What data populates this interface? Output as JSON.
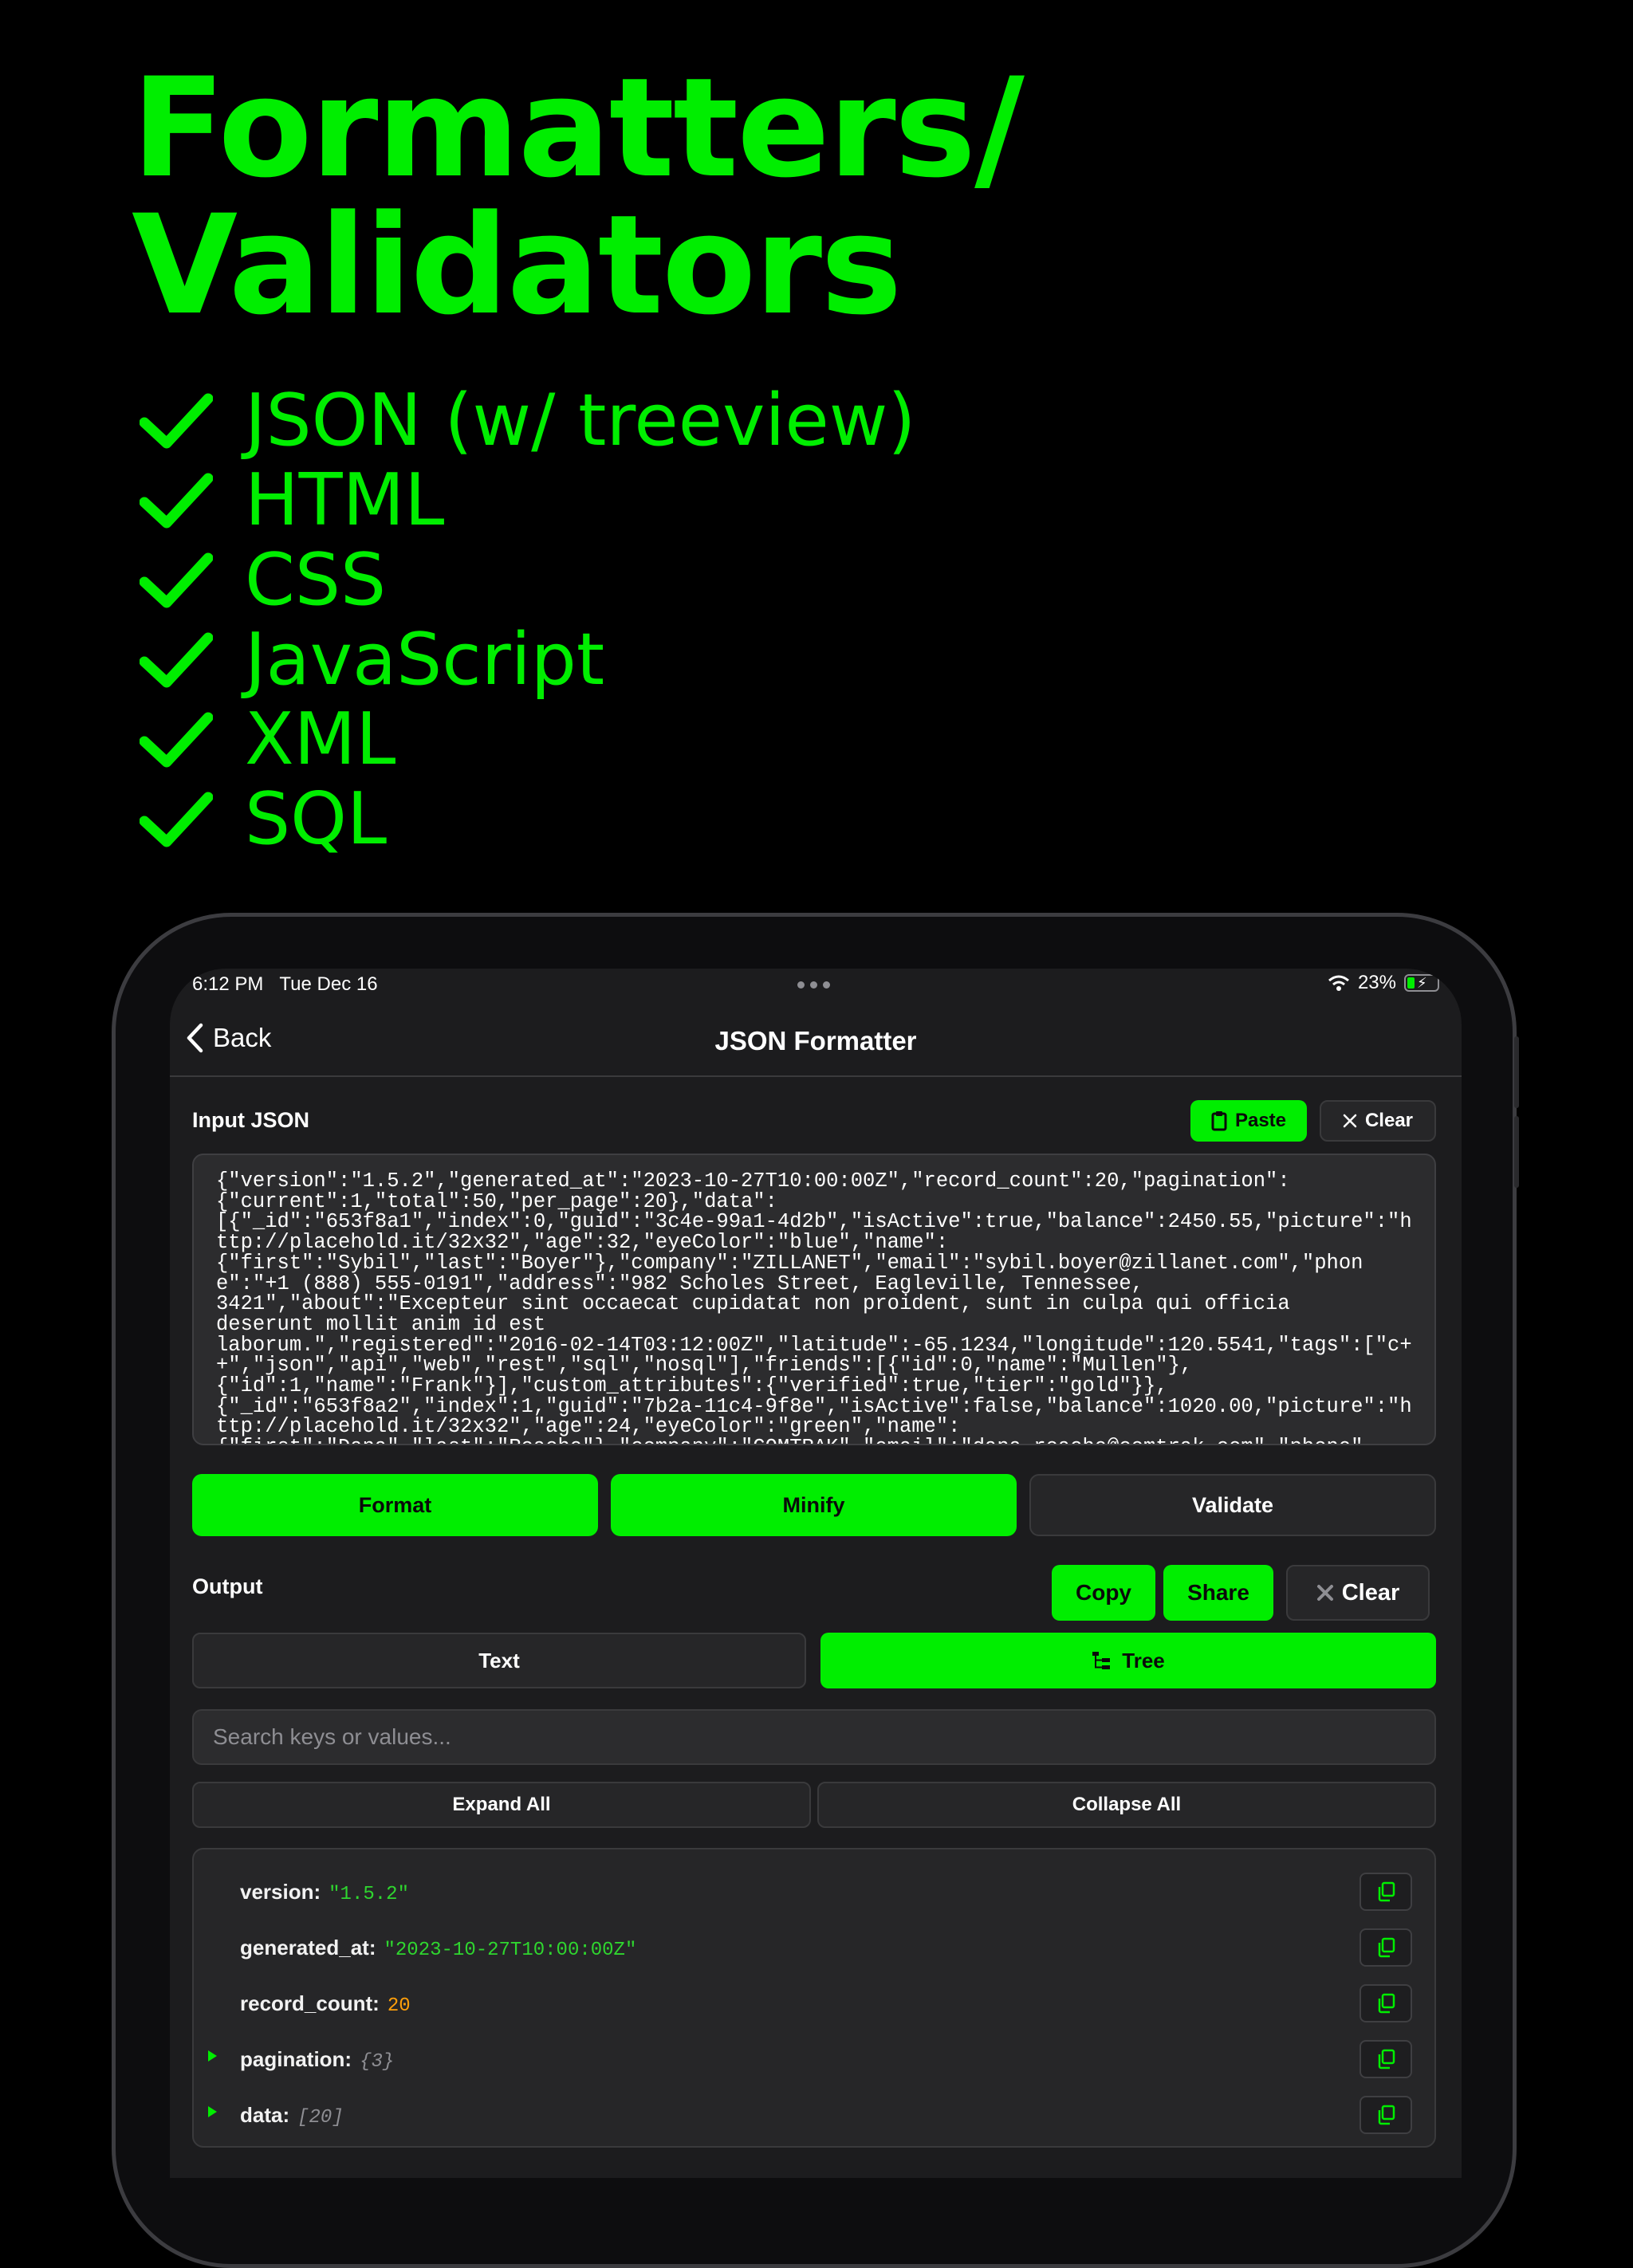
{
  "headline": {
    "line1": "Formatters/",
    "line2": "Validators"
  },
  "features": [
    "JSON (w/ treeview)",
    "HTML",
    "CSS",
    "JavaScript",
    "XML",
    "SQL"
  ],
  "status": {
    "time": "6:12 PM",
    "date": "Tue Dec 16",
    "battery": "23%"
  },
  "nav": {
    "back": "Back",
    "title": "JSON Formatter"
  },
  "input": {
    "label": "Input JSON",
    "paste": "Paste",
    "clear": "Clear",
    "text": "{\"version\":\"1.5.2\",\"generated_at\":\"2023-10-27T10:00:00Z\",\"record_count\":20,\"pagination\":\n{\"current\":1,\"total\":50,\"per_page\":20},\"data\":\n[{\"_id\":\"653f8a1\",\"index\":0,\"guid\":\"3c4e-99a1-4d2b\",\"isActive\":true,\"balance\":2450.55,\"picture\":\"http://placehold.it/32x32\",\"age\":32,\"eyeColor\":\"blue\",\"name\":\n{\"first\":\"Sybil\",\"last\":\"Boyer\"},\"company\":\"ZILLANET\",\"email\":\"sybil.boyer@zillanet.com\",\"phone\":\"+1 (888) 555-0191\",\"address\":\"982 Scholes Street, Eagleville, Tennessee,\n3421\",\"about\":\"Excepteur sint occaecat cupidatat non proident, sunt in culpa qui officia\ndeserunt mollit anim id est\nlaborum.\",\"registered\":\"2016-02-14T03:12:00Z\",\"latitude\":-65.1234,\"longitude\":120.5541,\"tags\":[\"c++\",\"json\",\"api\",\"web\",\"rest\",\"sql\",\"nosql\"],\"friends\":[{\"id\":0,\"name\":\"Mullen\"},\n{\"id\":1,\"name\":\"Frank\"}],\"custom_attributes\":{\"verified\":true,\"tier\":\"gold\"}},\n{\"_id\":\"653f8a2\",\"index\":1,\"guid\":\"7b2a-11c4-9f8e\",\"isActive\":false,\"balance\":1020.00,\"picture\":\"http://placehold.it/32x32\",\"age\":24,\"eyeColor\":\"green\",\"name\":\n{\"first\":\"Dana\",\"last\":\"Roache\"},\"company\":\"COMTRAK\",\"email\":\"dana.roache@comtrak.com\",\"phone\""
  },
  "actions": {
    "format": "Format",
    "minify": "Minify",
    "validate": "Validate"
  },
  "output": {
    "label": "Output",
    "copy": "Copy",
    "share": "Share",
    "clear": "Clear",
    "tab_text": "Text",
    "tab_tree": "Tree",
    "search_placeholder": "Search keys or values...",
    "expand_all": "Expand All",
    "collapse_all": "Collapse All"
  },
  "tree": [
    {
      "key": "version:",
      "value": "\"1.5.2\"",
      "kind": "str",
      "expandable": false
    },
    {
      "key": "generated_at:",
      "value": "\"2023-10-27T10:00:00Z\"",
      "kind": "str",
      "expandable": false
    },
    {
      "key": "record_count:",
      "value": "20",
      "kind": "num",
      "expandable": false
    },
    {
      "key": "pagination:",
      "value": "{3}",
      "kind": "meta",
      "expandable": true
    },
    {
      "key": "data:",
      "value": "[20]",
      "kind": "meta",
      "expandable": true
    }
  ],
  "colors": {
    "accent": "#00ee00",
    "background": "#000000",
    "panel": "#1c1c1e",
    "number": "#ff9f0a"
  }
}
